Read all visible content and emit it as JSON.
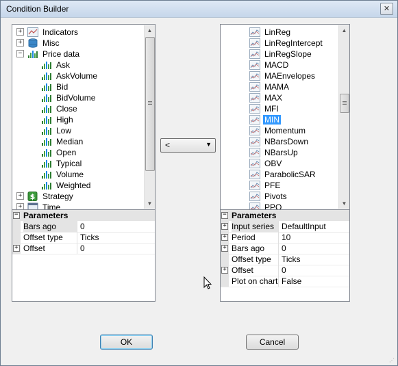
{
  "window": {
    "title": "Condition Builder",
    "close_label": "✕"
  },
  "left_tree": {
    "items": [
      {
        "label": "Indicators",
        "expander": "+",
        "icon": "chart-icon",
        "level": 0
      },
      {
        "label": "Misc",
        "expander": "+",
        "icon": "database-icon",
        "level": 0
      },
      {
        "label": "Price data",
        "expander": "−",
        "icon": "bar-chart-icon",
        "level": 0
      },
      {
        "label": "Ask",
        "icon": "bar-chart-icon",
        "level": 1
      },
      {
        "label": "AskVolume",
        "icon": "bar-chart-icon",
        "level": 1
      },
      {
        "label": "Bid",
        "icon": "bar-chart-icon",
        "level": 1
      },
      {
        "label": "BidVolume",
        "icon": "bar-chart-icon",
        "level": 1
      },
      {
        "label": "Close",
        "icon": "bar-chart-icon",
        "level": 1
      },
      {
        "label": "High",
        "icon": "bar-chart-icon",
        "level": 1
      },
      {
        "label": "Low",
        "icon": "bar-chart-icon",
        "level": 1
      },
      {
        "label": "Median",
        "icon": "bar-chart-icon",
        "level": 1
      },
      {
        "label": "Open",
        "icon": "bar-chart-icon",
        "level": 1
      },
      {
        "label": "Typical",
        "icon": "bar-chart-icon",
        "level": 1
      },
      {
        "label": "Volume",
        "icon": "bar-chart-icon",
        "level": 1
      },
      {
        "label": "Weighted",
        "icon": "bar-chart-icon",
        "level": 1
      },
      {
        "label": "Strategy",
        "expander": "+",
        "icon": "dollar-icon",
        "level": 0
      },
      {
        "label": "Time",
        "expander": "+",
        "icon": "calendar-icon",
        "level": 0
      }
    ]
  },
  "left_params": {
    "header": "Parameters",
    "header_toggle": "−",
    "rows": [
      {
        "name": "Bars ago",
        "value": "0",
        "expander": ""
      },
      {
        "name": "Offset type",
        "value": "Ticks",
        "expander": ""
      },
      {
        "name": "Offset",
        "value": "0",
        "expander": "+"
      }
    ]
  },
  "right_tree": {
    "items": [
      {
        "label": "LinReg"
      },
      {
        "label": "LinRegIntercept"
      },
      {
        "label": "LinRegSlope"
      },
      {
        "label": "MACD"
      },
      {
        "label": "MAEnvelopes"
      },
      {
        "label": "MAMA"
      },
      {
        "label": "MAX"
      },
      {
        "label": "MFI"
      },
      {
        "label": "MIN",
        "selected": true
      },
      {
        "label": "Momentum"
      },
      {
        "label": "NBarsDown"
      },
      {
        "label": "NBarsUp"
      },
      {
        "label": "OBV"
      },
      {
        "label": "ParabolicSAR"
      },
      {
        "label": "PFE"
      },
      {
        "label": "Pivots"
      },
      {
        "label": "PPO"
      }
    ]
  },
  "right_params": {
    "header": "Parameters",
    "header_toggle": "−",
    "rows": [
      {
        "name": "Input series",
        "value": "DefaultInput",
        "expander": "+"
      },
      {
        "name": "Period",
        "value": "10",
        "expander": "+"
      },
      {
        "name": "Bars ago",
        "value": "0",
        "expander": "+"
      },
      {
        "name": "Offset type",
        "value": "Ticks",
        "expander": ""
      },
      {
        "name": "Offset",
        "value": "0",
        "expander": "+"
      },
      {
        "name": "Plot on chart",
        "value": "False",
        "expander": ""
      }
    ]
  },
  "operator": {
    "value": "<"
  },
  "buttons": {
    "ok": "OK",
    "cancel": "Cancel"
  }
}
